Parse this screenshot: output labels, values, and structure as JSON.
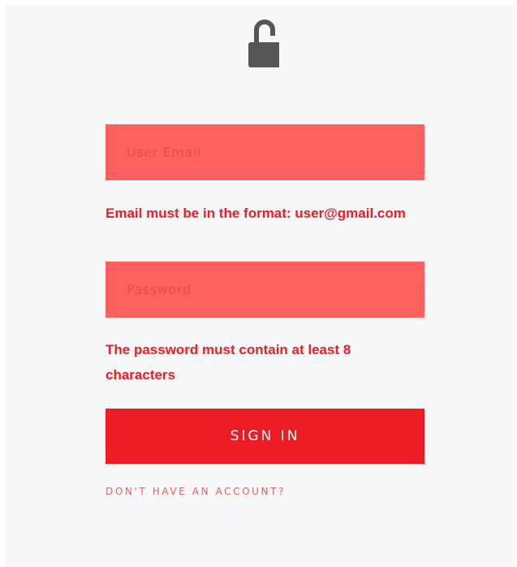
{
  "header": {
    "icon": "unlocked-padlock-icon",
    "icon_color": "#555555"
  },
  "form": {
    "email": {
      "placeholder": "User Email",
      "value": "",
      "error": "Email must be in the format: user@gmail.com"
    },
    "password": {
      "placeholder": "Password",
      "value": "",
      "error": "The password must contain at least 8 characters"
    },
    "signin_label": "SIGN IN",
    "account_link": "DON'T HAVE AN ACCOUNT?"
  },
  "colors": {
    "background": "#f6f7f9",
    "field_error_bg": "#ff6161",
    "error_text": "#ee1c25",
    "button_bg": "#ec1c24",
    "button_text": "#ffffff",
    "link_text": "#e86060"
  }
}
